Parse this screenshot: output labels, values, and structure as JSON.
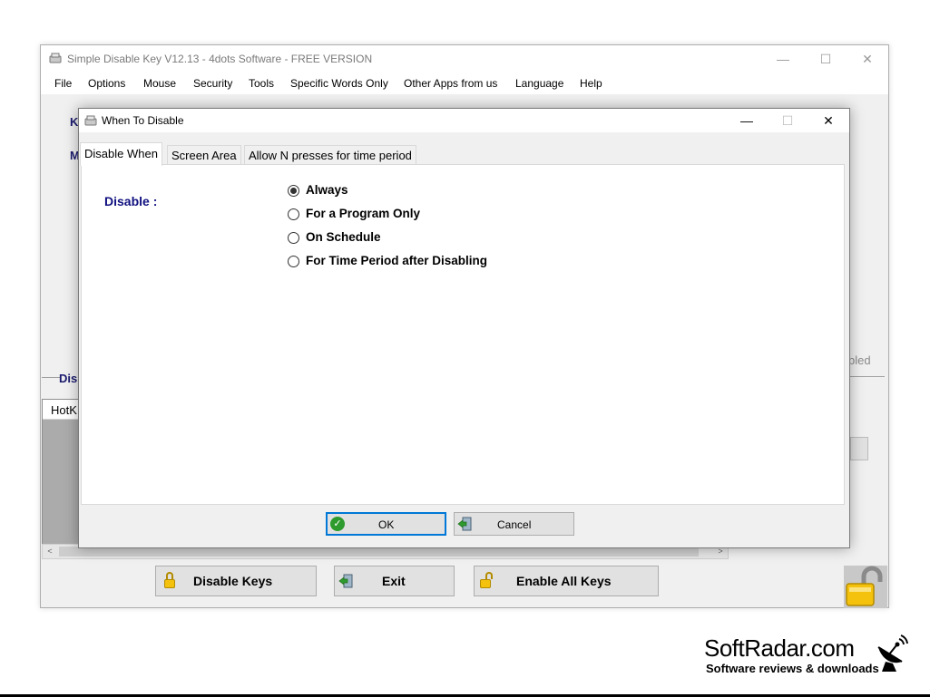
{
  "main_window": {
    "title": "Simple Disable Key V12.13 - 4dots Software - FREE VERSION",
    "minimize_glyph": "—",
    "maximize_glyph": "☐",
    "close_glyph": "✕",
    "menu": [
      "File",
      "Options",
      "Mouse",
      "Security",
      "Tools",
      "Specific Words Only",
      "Other Apps from us",
      "Language",
      "Help"
    ],
    "partial_labels": {
      "k": "K",
      "m": "M",
      "dis": "Dis",
      "bled": "bled",
      "hotkey_col": "HotK"
    },
    "bottom_buttons": {
      "disable_keys": "Disable Keys",
      "exit": "Exit",
      "enable_all_keys": "Enable All Keys"
    }
  },
  "dialog": {
    "title": "When To Disable",
    "minimize_glyph": "—",
    "maximize_glyph": "☐",
    "close_glyph": "✕",
    "tabs": [
      {
        "label": "Disable When",
        "active": true
      },
      {
        "label": "Screen Area",
        "active": false
      },
      {
        "label": "Allow N presses for time period",
        "active": false
      }
    ],
    "disable_label": "Disable :",
    "options": [
      {
        "label": "Always",
        "checked": true
      },
      {
        "label": "For a Program Only",
        "checked": false
      },
      {
        "label": "On Schedule",
        "checked": false
      },
      {
        "label": "For Time Period after Disabling",
        "checked": false
      }
    ],
    "ok_label": "OK",
    "cancel_label": "Cancel"
  },
  "watermark": {
    "brand": "SoftRadar.com",
    "tagline": "Software reviews & downloads"
  },
  "colors": {
    "label_blue": "#101080",
    "primary_border": "#0078d7",
    "lock_yellow": "#f4c20d"
  }
}
